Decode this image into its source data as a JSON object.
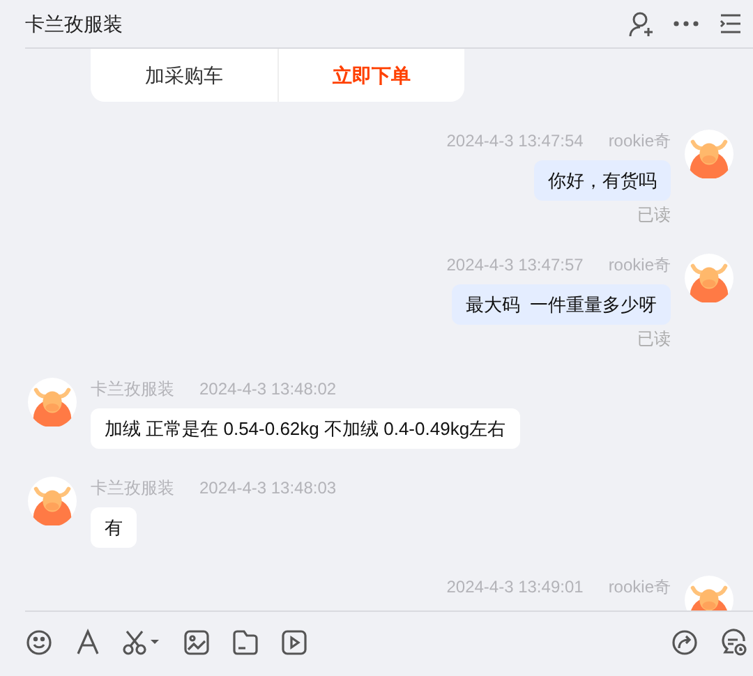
{
  "header": {
    "title": "卡兰孜服装"
  },
  "product_actions": [
    {
      "label": "加采购车",
      "kind": "secondary"
    },
    {
      "label": "立即下单",
      "kind": "primary"
    }
  ],
  "messages": [
    {
      "mine": true,
      "time": "2024-4-3 13:47:54",
      "sender": "rookie奇",
      "text": "你好，有货吗",
      "status": "已读"
    },
    {
      "mine": true,
      "time": "2024-4-3 13:47:57",
      "sender": "rookie奇",
      "text": "最大码  一件重量多少呀",
      "status": "已读"
    },
    {
      "mine": false,
      "time": "2024-4-3 13:48:02",
      "sender": "卡兰孜服装",
      "text": "加绒 正常是在 0.54-0.62kg 不加绒 0.4-0.49kg左右"
    },
    {
      "mine": false,
      "time": "2024-4-3 13:48:03",
      "sender": "卡兰孜服装",
      "text": "有"
    },
    {
      "mine": true,
      "time": "2024-4-3 13:49:01",
      "sender": "rookie奇"
    }
  ]
}
